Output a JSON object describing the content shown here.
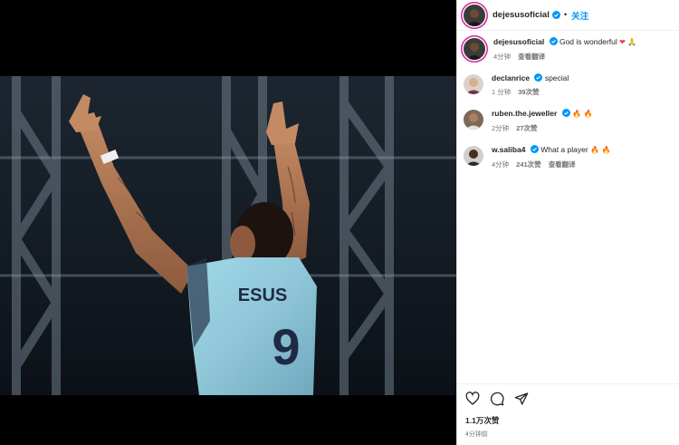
{
  "post": {
    "username": "dejesusoficial",
    "follow_label": "关注",
    "dot": "•",
    "caption_text": "God is wonderful",
    "caption_emojis": "❤ 🙏",
    "caption_time": "4分钟",
    "translate_label": "查看翻译"
  },
  "comments": [
    {
      "username": "declanrice",
      "text": "special",
      "emojis": "",
      "time": "1 分钟",
      "likes": "39次赞",
      "translate": ""
    },
    {
      "username": "ruben.the.jeweller",
      "text": "",
      "emojis": "🔥 🔥",
      "time": "2分钟",
      "likes": "27次赞",
      "translate": ""
    },
    {
      "username": "w.saliba4",
      "text": "What a player",
      "emojis": "🔥 🔥",
      "time": "4分钟",
      "likes": "241次赞",
      "translate": "查看翻译"
    }
  ],
  "footer": {
    "likes_count": "1.1万次赞",
    "posted_time": "4分钟前"
  },
  "colors": {
    "accent": "#0095f6",
    "verified": "#0095f6",
    "text": "#262626",
    "muted": "#737373"
  },
  "icons": [
    "heart-icon",
    "comment-icon",
    "share-icon",
    "verified-icon"
  ]
}
